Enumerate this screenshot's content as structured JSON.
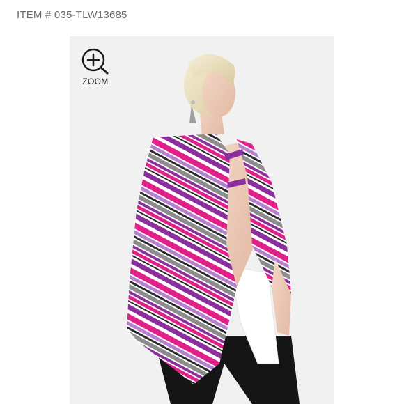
{
  "header": {
    "item_number": "ITEM # 035-TLW13685"
  },
  "product_image": {
    "zoom_label": "ZOOM",
    "zoom_icon": "zoom-in-icon",
    "colors": {
      "background": "#f1f1f1",
      "magenta": "#e0218a",
      "purple": "#8a2f9c",
      "lilac": "#b77fd0",
      "gray": "#8c8c8c",
      "charcoal": "#2a2a2a",
      "white": "#ffffff"
    }
  }
}
